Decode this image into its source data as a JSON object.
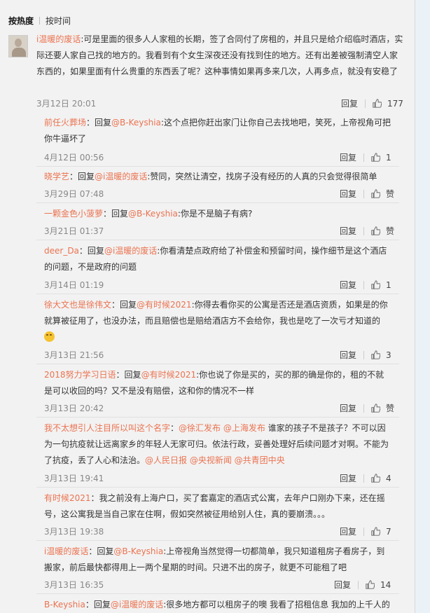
{
  "sort": {
    "hot": "按热度",
    "time": "按时间"
  },
  "actions": {
    "reply": "回复"
  },
  "main": {
    "user": "i温暖的废话",
    "colon": ":",
    "text": "可是里面的很多人人家租的长期，签了合同付了房租的，并且只是给介绍临时酒店，实际还要人家自己找的地方的。我看到有个女生深夜还没有找到住的地方。还有出差被强制清空人家东西的，如果里面有什么贵重的东西丢了呢？这种事情如果再多来几次，人再多点，就没有安稳了",
    "time": "3月12日 20:01",
    "likes": "177"
  },
  "replies": [
    {
      "user": "前任火葬场",
      "sep": "：回复",
      "target": "@B-Keyshia",
      "text": ":这个点把你赶出家门让你自己去找地吧，笑死，上帝视角可把你牛逼坏了",
      "time": "4月12日 00:56",
      "likes": "1"
    },
    {
      "user": "晓学艺",
      "sep": "：回复",
      "target": "@i温暖的废话",
      "text": ":赞同，突然让清空，找房子没有经历的人真的只会觉得很简单",
      "time": "3月29日 07:48",
      "likes": "赞"
    },
    {
      "user": "一颗金色小菠萝",
      "sep": "：回复",
      "target": "@B-Keyshia",
      "text": ":你是不是脑子有病?",
      "time": "3月21日 01:37",
      "likes": "赞"
    },
    {
      "user": "deer_Da",
      "sep": "：回复",
      "target": "@i温暖的废话",
      "text": ":你看清楚点政府给了补偿金和预留时间，操作细节是这个酒店的问题，不是政府的问题",
      "time": "3月14日 01:19",
      "likes": "1"
    },
    {
      "user": "徐大文也是徐伟文",
      "sep": "：回复",
      "target": "@有时候2021",
      "text": ":你得去看你买的公寓是否还是酒店资质，如果是的你就算被征用了，也没办法，而且赔偿也是赔给酒店方不会给你，我也是吃了一次亏才知道的",
      "time": "3月13日 21:56",
      "likes": "3"
    },
    {
      "user": "2018努力学习日语",
      "sep": "：回复",
      "target": "@有时候2021",
      "text": ":你也说了你是买的，买的那的确是你的，租的不就是可以收回的吗？又不是没有赔偿，这和你的情况不一样",
      "time": "3月13日 20:42",
      "likes": "赞"
    },
    {
      "user": "我不太想引人注目所以叫这个名字",
      "sep": "：",
      "target": "@徐汇发布 @上海发布",
      "text": " 谁家的孩子不是孩子？不可以因为一句抗疫就让远离家乡的年轻人无家可归。依法行政，妥善处理好后续问题才对啊。不能为了抗疫，丢了人心和法治。",
      "target2": "@人民日报 @央视新闻 @共青团中央",
      "time": "3月13日 19:41",
      "likes": "4"
    },
    {
      "user": "有时候2021",
      "sep": "：",
      "target": "",
      "text": "我之前没有上海户口，买了套嘉定的酒店式公寓，去年户口刚办下来，还在摇号，这公寓我是当自己家在住啊，假如突然被征用给别人住，真的要崩溃。。。",
      "time": "3月13日 19:38",
      "likes": "7"
    },
    {
      "user": "i温暖的废话",
      "sep": "：回复",
      "target": "@B-Keyshia",
      "text": ":上帝视角当然觉得一切都简单，我只知道租房子看房子，到搬家，前后最快都得用上一两个星期的时间。只进不出的房子，就更不可能租了吧",
      "time": "3月13日 16:35",
      "likes": "14"
    },
    {
      "user": "B-Keyshia",
      "sep": "：回复",
      "target": "@i温暖的废话",
      "text": ":很多地方都可以租房子的噢 我看了招租信息 我加的上千人的"
    }
  ],
  "colors": {
    "name": "#eb7350",
    "bg": "#f2f2f2",
    "text": "#333333",
    "meta": "#888888"
  },
  "icons": {
    "like": "thumb-up-icon",
    "emoji": "laughing-emoji-icon"
  }
}
